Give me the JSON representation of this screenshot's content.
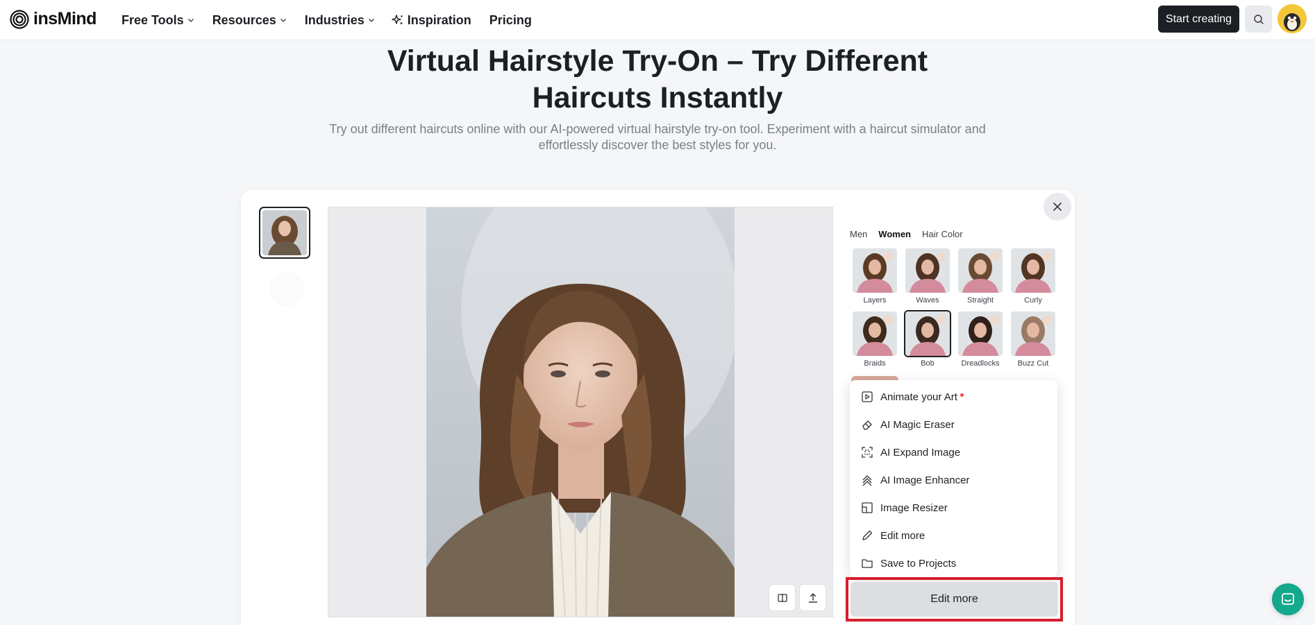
{
  "header": {
    "brand": "insMind",
    "nav": [
      {
        "label": "Free Tools",
        "dropdown": true
      },
      {
        "label": "Resources",
        "dropdown": true
      },
      {
        "label": "Industries",
        "dropdown": true
      },
      {
        "label": "Inspiration",
        "icon": "sparkle-icon"
      },
      {
        "label": "Pricing"
      }
    ],
    "start_label": "Start creating"
  },
  "hero": {
    "title_line1": "Virtual Hairstyle Try-On – Try Different",
    "title_line2": "Haircuts Instantly",
    "subtitle_line1": "Try out different haircuts online with our AI-powered virtual hairstyle try-on tool. Experiment with a haircut simulator and",
    "subtitle_line2": "effortlessly discover the best styles for you."
  },
  "panel": {
    "tabs": [
      {
        "label": "Men",
        "active": false
      },
      {
        "label": "Women",
        "active": true
      },
      {
        "label": "Hair Color",
        "active": false
      }
    ],
    "styles": [
      {
        "label": "Layers",
        "hair": "#5b3a26",
        "selected": false
      },
      {
        "label": "Waves",
        "hair": "#4e3222",
        "selected": false
      },
      {
        "label": "Straight",
        "hair": "#6a4a34",
        "selected": false
      },
      {
        "label": "Curly",
        "hair": "#533523",
        "selected": false
      },
      {
        "label": "Braids",
        "hair": "#3f2a1e",
        "selected": false
      },
      {
        "label": "Bob",
        "hair": "#3a2a20",
        "selected": true
      },
      {
        "label": "Dreadlocks",
        "hair": "#2f2119",
        "selected": false
      },
      {
        "label": "Buzz Cut",
        "hair": "#9a7a66",
        "selected": false
      }
    ]
  },
  "menu": {
    "items": [
      {
        "label": "Animate your Art",
        "icon": "animate-icon",
        "new_badge": true
      },
      {
        "label": "AI Magic Eraser",
        "icon": "eraser-icon"
      },
      {
        "label": "AI Expand Image",
        "icon": "expand-icon"
      },
      {
        "label": "AI Image Enhancer",
        "icon": "enhance-icon"
      },
      {
        "label": "Image Resizer",
        "icon": "resize-icon"
      },
      {
        "label": "Edit more",
        "icon": "pencil-icon"
      },
      {
        "label": "Save to Projects",
        "icon": "folder-icon"
      }
    ]
  },
  "edit_more_label": "Edit more",
  "colors": {
    "accent_dark": "#1c1f23",
    "highlight": "#d81e2c",
    "chat": "#14a88c"
  }
}
